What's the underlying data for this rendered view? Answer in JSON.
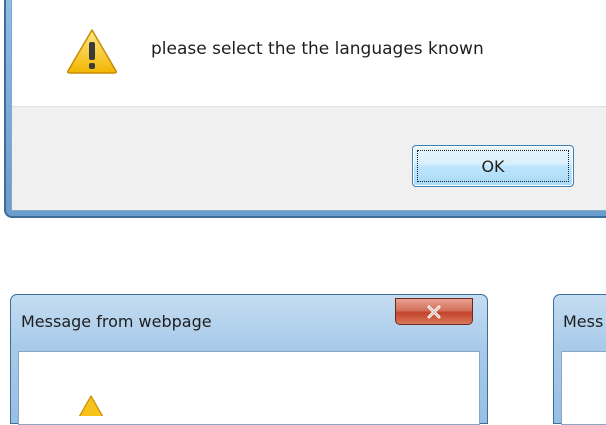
{
  "dialog_top": {
    "message": "please select the the languages known",
    "ok_label": "OK",
    "icon": "warning-icon"
  },
  "dialog_bottom_left": {
    "title": "Message from webpage",
    "close_icon": "close-icon",
    "icon": "warning-icon"
  },
  "dialog_bottom_right": {
    "title_visible": "Mess"
  },
  "colors": {
    "frame_blue": "#97bfe3",
    "ok_button_blue": "#bee6fd",
    "close_red": "#c2442a",
    "warning_yellow": "#f7c21a"
  }
}
